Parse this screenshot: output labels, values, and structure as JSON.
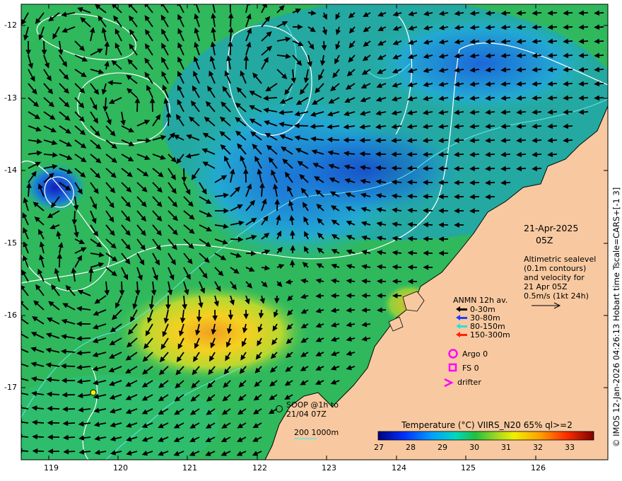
{
  "x_ticks": [
    "119",
    "120",
    "121",
    "122",
    "123",
    "124",
    "125",
    "126"
  ],
  "y_ticks": [
    "-12",
    "-13",
    "-14",
    "-15",
    "-16",
    "-17"
  ],
  "date": "21-Apr-2025",
  "time": "05Z",
  "altimetric_lines": [
    "Altimetric sealevel",
    "(0.1m contours)",
    "and velocity for",
    "21 Apr 05Z",
    "0.5m/s (1kt 24h)"
  ],
  "anmn": {
    "title": "ANMN 12h av.",
    "rows": [
      {
        "label": "0-30m",
        "color": "#000000"
      },
      {
        "label": "30-80m",
        "color": "#1f3fff"
      },
      {
        "label": "80-150m",
        "color": "#33dddd"
      },
      {
        "label": "150-300m",
        "color": "#ff2200"
      }
    ]
  },
  "argo": "Argo 0",
  "fs": "FS 0",
  "drifter": "drifter",
  "soop_line1": "SOOP @1h to",
  "soop_line2": "21/04 07Z",
  "depth_label": "200  1000m",
  "colorbar": {
    "title": "Temperature (°C) VIIRS_N20 65% ql>=2",
    "ticks": [
      "27",
      "28",
      "29",
      "30",
      "31",
      "32",
      "33"
    ]
  },
  "credit": "© IMOS 12-Jan-2026 04:26:13 Hobart time Tscale=CARS+[-1 3]",
  "colors": {
    "land": "#f8c9a0",
    "magenta": "#ff00ff",
    "contour": "#ffffff",
    "depth": "#66e6e6"
  }
}
